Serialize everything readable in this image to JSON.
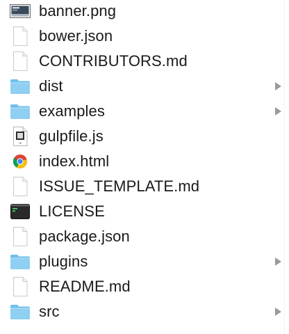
{
  "files": [
    {
      "name": "banner.png",
      "icon": "image-thumbnail-icon",
      "kind": "image",
      "expandable": false
    },
    {
      "name": "bower.json",
      "icon": "document-icon",
      "kind": "doc",
      "expandable": false
    },
    {
      "name": "CONTRIBUTORS.md",
      "icon": "document-icon",
      "kind": "doc",
      "expandable": false
    },
    {
      "name": "dist",
      "icon": "folder-icon",
      "kind": "folder",
      "expandable": true
    },
    {
      "name": "examples",
      "icon": "folder-icon",
      "kind": "folder",
      "expandable": true
    },
    {
      "name": "gulpfile.js",
      "icon": "js-file-icon",
      "kind": "js",
      "expandable": false
    },
    {
      "name": "index.html",
      "icon": "chrome-html-icon",
      "kind": "html",
      "expandable": false
    },
    {
      "name": "ISSUE_TEMPLATE.md",
      "icon": "document-icon",
      "kind": "doc",
      "expandable": false
    },
    {
      "name": "LICENSE",
      "icon": "terminal-icon",
      "kind": "terminal",
      "expandable": false
    },
    {
      "name": "package.json",
      "icon": "document-icon",
      "kind": "doc",
      "expandable": false
    },
    {
      "name": "plugins",
      "icon": "folder-icon",
      "kind": "folder",
      "expandable": true
    },
    {
      "name": "README.md",
      "icon": "document-icon",
      "kind": "doc",
      "expandable": false
    },
    {
      "name": "src",
      "icon": "folder-icon",
      "kind": "folder",
      "expandable": true
    }
  ],
  "colors": {
    "folder_body": "#8ecff2",
    "folder_tab": "#6fbfea",
    "disclosure": "#9a9a9a",
    "text": "#1a1a1a"
  }
}
